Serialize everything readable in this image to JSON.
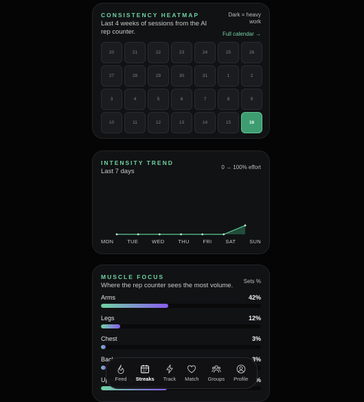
{
  "heatmap": {
    "title": "CONSISTENCY HEATMAP",
    "subtitle": "Last 4 weeks of sessions from the AI rep counter.",
    "hint": "Dark = heavy work",
    "link": "Full calendar →",
    "days": [
      {
        "label": "20",
        "level": 0
      },
      {
        "label": "21",
        "level": 0
      },
      {
        "label": "22",
        "level": 0
      },
      {
        "label": "23",
        "level": 0
      },
      {
        "label": "24",
        "level": 0
      },
      {
        "label": "25",
        "level": 0
      },
      {
        "label": "26",
        "level": 0
      },
      {
        "label": "27",
        "level": 0
      },
      {
        "label": "28",
        "level": 0
      },
      {
        "label": "29",
        "level": 0
      },
      {
        "label": "30",
        "level": 0
      },
      {
        "label": "31",
        "level": 0
      },
      {
        "label": "1",
        "level": 0
      },
      {
        "label": "2",
        "level": 0
      },
      {
        "label": "3",
        "level": 0
      },
      {
        "label": "4",
        "level": 0
      },
      {
        "label": "5",
        "level": 0
      },
      {
        "label": "6",
        "level": 0
      },
      {
        "label": "7",
        "level": 0
      },
      {
        "label": "8",
        "level": 0
      },
      {
        "label": "9",
        "level": 0
      },
      {
        "label": "10",
        "level": 0
      },
      {
        "label": "11",
        "level": 0
      },
      {
        "label": "12",
        "level": 0
      },
      {
        "label": "13",
        "level": 0
      },
      {
        "label": "14",
        "level": 0
      },
      {
        "label": "15",
        "level": 0
      },
      {
        "label": "16",
        "level": 1
      }
    ]
  },
  "trend": {
    "title": "INTENSITY TREND",
    "subtitle": "Last 7 days",
    "hint": "0 → 100% effort",
    "chart_data": {
      "type": "area",
      "categories": [
        "MON",
        "TUE",
        "WED",
        "THU",
        "FRI",
        "SAT",
        "SUN"
      ],
      "values": [
        0,
        0,
        0,
        0,
        0,
        0,
        16
      ],
      "ylim": [
        0,
        100
      ],
      "grid": false
    },
    "colors": {
      "line": "#5fc795",
      "fill": "#2f7e5a"
    }
  },
  "muscle": {
    "title": "MUSCLE FOCUS",
    "subtitle": "Where the rep counter sees the most volume.",
    "hint": "Sets %",
    "items": [
      {
        "label": "Arms",
        "pct": "42%",
        "value": 42
      },
      {
        "label": "Legs",
        "pct": "12%",
        "value": 12
      },
      {
        "label": "Chest",
        "pct": "3%",
        "value": 3
      },
      {
        "label": "Back",
        "pct": "3%",
        "value": 3
      },
      {
        "label": "Upper body",
        "pct": "%",
        "value": 41
      }
    ]
  },
  "nav": {
    "items": [
      {
        "label": "Feed",
        "icon": "flame-icon",
        "active": false
      },
      {
        "label": "Streaks",
        "icon": "calendar-icon",
        "active": true
      },
      {
        "label": "Track",
        "icon": "bolt-icon",
        "active": false
      },
      {
        "label": "Match",
        "icon": "heart-icon",
        "active": false
      },
      {
        "label": "Groups",
        "icon": "group-icon",
        "active": false
      },
      {
        "label": "Profile",
        "icon": "profile-icon",
        "active": false
      }
    ]
  }
}
